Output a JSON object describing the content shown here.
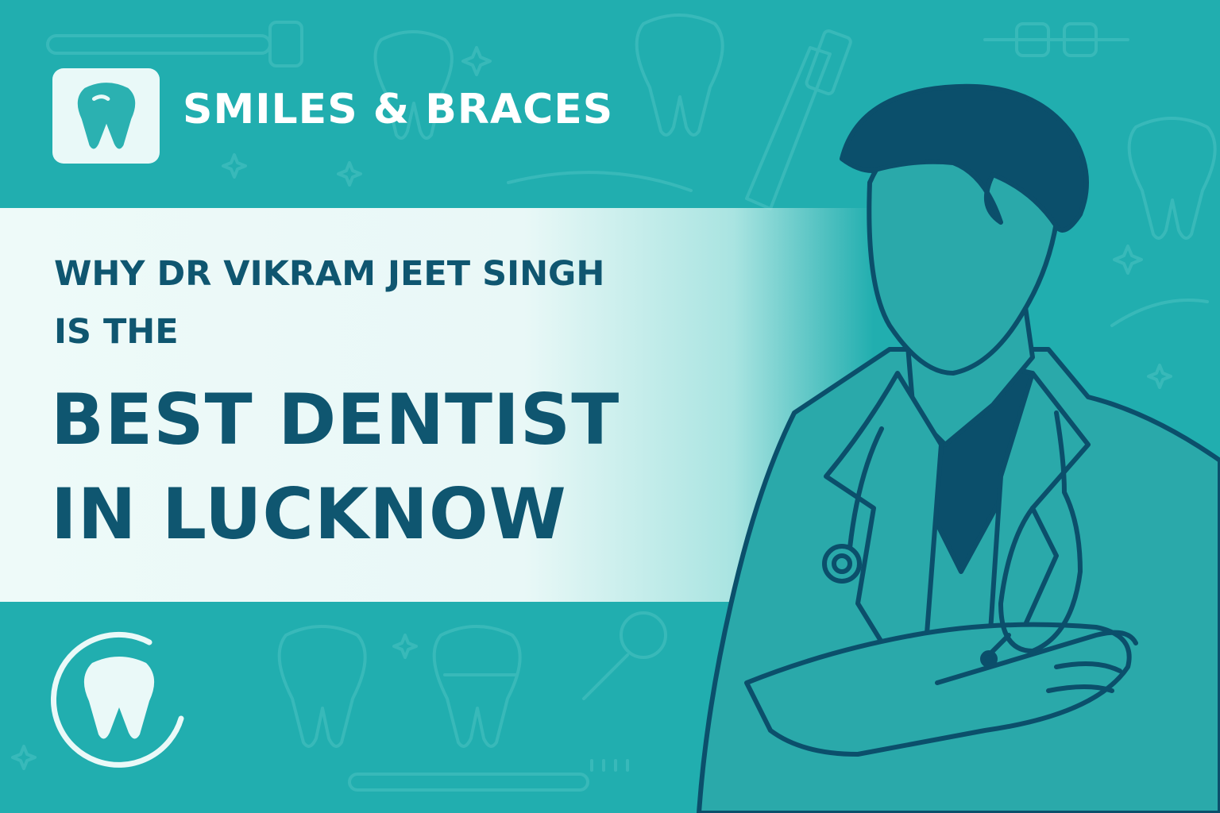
{
  "brand": {
    "name": "SMILES & BRACES"
  },
  "headline": {
    "line1": "WHY DR VIKRAM JEET SINGH",
    "line2": "IS THE",
    "line3": "BEST DENTIST",
    "line4": "IN LUCKNOW"
  },
  "colors": {
    "background": "#21aeaf",
    "banner": "#eefaf9",
    "headline": "#0f5670",
    "doctor_dark": "#0b4f6b",
    "brand_text": "#ffffff"
  },
  "icons": [
    "tooth-icon",
    "circle-tooth-icon",
    "doctor-illustration",
    "stethoscope-icon"
  ]
}
